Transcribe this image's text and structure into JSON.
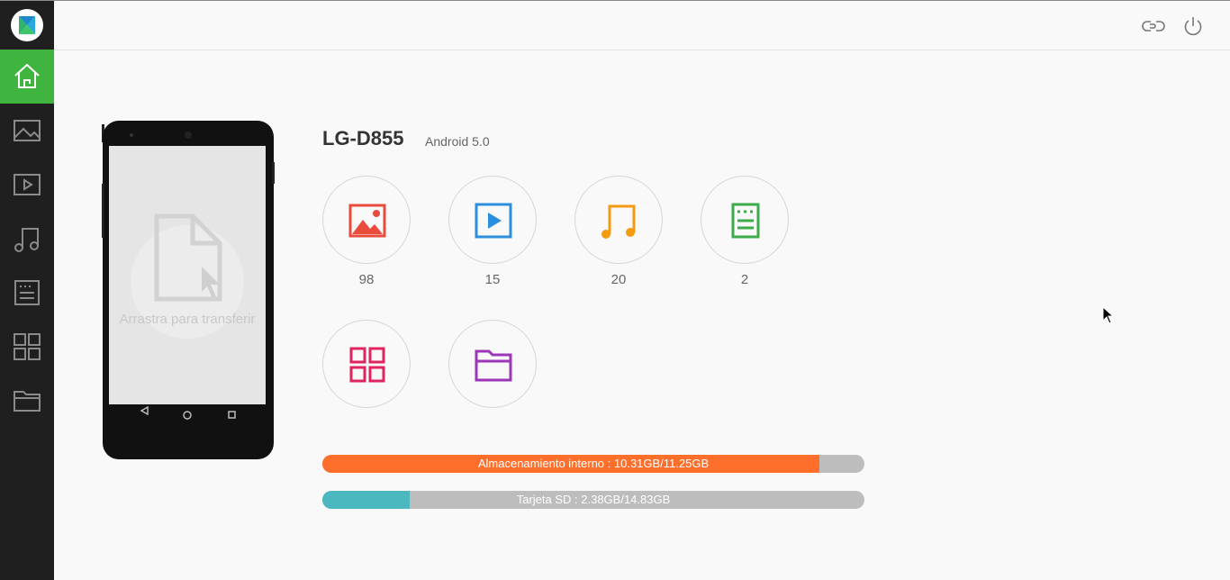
{
  "sidebar": {
    "items": [
      {
        "name": "home",
        "active": true
      },
      {
        "name": "photos"
      },
      {
        "name": "videos"
      },
      {
        "name": "music"
      },
      {
        "name": "documents"
      },
      {
        "name": "apps"
      },
      {
        "name": "files"
      }
    ]
  },
  "header": {
    "icons": [
      "link-icon",
      "power-icon"
    ]
  },
  "phone": {
    "drop_text": "Arrastra para transferir"
  },
  "device": {
    "name": "LG-D855",
    "android": "Android 5.0"
  },
  "categories": [
    {
      "name": "photos",
      "count": "98",
      "color": "#e94b3c"
    },
    {
      "name": "videos",
      "count": "15",
      "color": "#2b8fe0"
    },
    {
      "name": "music",
      "count": "20",
      "color": "#f39c12"
    },
    {
      "name": "documents",
      "count": "2",
      "color": "#3dab4a"
    },
    {
      "name": "apps",
      "count": "",
      "color": "#e0245e"
    },
    {
      "name": "files",
      "count": "",
      "color": "#9b36b7"
    }
  ],
  "storage": {
    "internal": {
      "label": "Almacenamiento interno : 10.31GB/11.25GB",
      "fraction": 0.9165,
      "color": "#ff6f2c"
    },
    "sd": {
      "label": "Tarjeta SD : 2.38GB/14.83GB",
      "fraction": 0.1605,
      "color": "#4bb8c0"
    }
  },
  "colors": {
    "sidebar_bg": "#1f1f1f",
    "active": "#3fb43f",
    "bar_bg": "#bdbdbd"
  }
}
